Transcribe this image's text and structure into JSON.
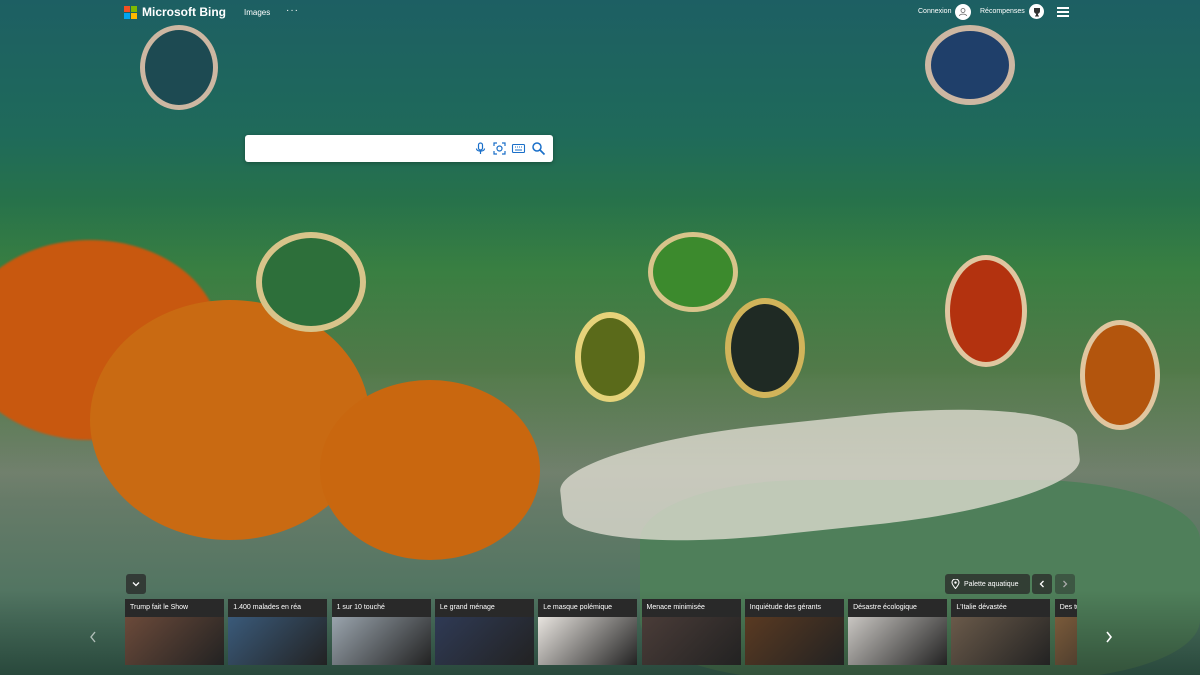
{
  "header": {
    "brand": "Microsoft Bing",
    "nav_images": "Images",
    "nav_more": "···",
    "signin": "Connexion",
    "rewards": "Récompenses"
  },
  "search": {
    "value": "",
    "placeholder": ""
  },
  "icons": {
    "mic": "microphone-icon",
    "visual_search": "visual-search-icon",
    "keyboard": "keyboard-icon",
    "search": "search-icon",
    "expand": "chevron-down-icon",
    "location": "location-pin-icon",
    "prev": "chevron-left-icon",
    "next": "chevron-right-icon"
  },
  "image_info": {
    "label": "Palette aquatique"
  },
  "news": [
    {
      "title": "Trump fait le Show",
      "color": "#6b4a3a"
    },
    {
      "title": "1.400 malades en réa",
      "color": "#3a5a7a"
    },
    {
      "title": "1 sur 10 touché",
      "color": "#9aa4ad"
    },
    {
      "title": "Le grand ménage",
      "color": "#2f3a55"
    },
    {
      "title": "Le masque polémique",
      "color": "#e8e4df"
    },
    {
      "title": "Menace minimisée",
      "color": "#4a3c38"
    },
    {
      "title": "Inquiétude des gérants",
      "color": "#5a3a22"
    },
    {
      "title": "Désastre écologique",
      "color": "#c9c6c2"
    },
    {
      "title": "L'Italie dévastée",
      "color": "#6a5a4a"
    },
    {
      "title": "Des tu",
      "color": "#7a5a3a"
    }
  ],
  "colors": {
    "accent": "#ffffff",
    "panel": "#282828"
  }
}
